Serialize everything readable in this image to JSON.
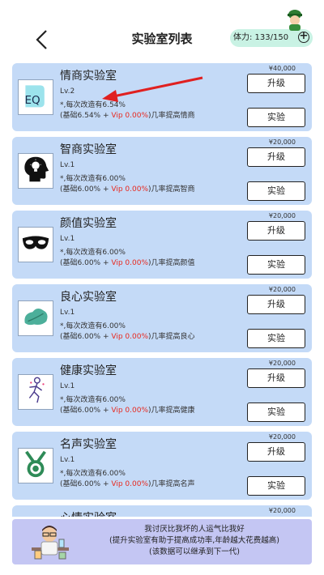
{
  "header": {
    "title": "实验室列表",
    "stamina_label": "体力: 133/150"
  },
  "labs": [
    {
      "name": "情商实验室",
      "level": "Lv.2",
      "desc": "*,每次改造有6.54%",
      "formula_prefix": "(基础6.54% + ",
      "vip": "Vip 0.00%",
      "formula_suffix": ")几率提高情商",
      "price": "¥40,000",
      "upgrade": "升级",
      "experiment": "实验",
      "icon": "eq-icon"
    },
    {
      "name": "智商实验室",
      "level": "Lv.1",
      "desc": "*,每次改造有6.00%",
      "formula_prefix": "(基础6.00% + ",
      "vip": "Vip 0.00%",
      "formula_suffix": ")几率提高智商",
      "price": "¥20,000",
      "upgrade": "升级",
      "experiment": "实验",
      "icon": "brain-bulb-icon"
    },
    {
      "name": "颜值实验室",
      "level": "Lv.1",
      "desc": "*,每次改造有6.00%",
      "formula_prefix": "(基础6.00% + ",
      "vip": "Vip 0.00%",
      "formula_suffix": ")几率提高颜值",
      "price": "¥20,000",
      "upgrade": "升级",
      "experiment": "实验",
      "icon": "mask-icon"
    },
    {
      "name": "良心实验室",
      "level": "Lv.1",
      "desc": "*,每次改造有6.00%",
      "formula_prefix": "(基础6.00% + ",
      "vip": "Vip 0.00%",
      "formula_suffix": ")几率提高良心",
      "price": "¥20,000",
      "upgrade": "升级",
      "experiment": "实验",
      "icon": "leaf-icon"
    },
    {
      "name": "健康实验室",
      "level": "Lv.1",
      "desc": "*,每次改造有6.00%",
      "formula_prefix": "(基础6.00% + ",
      "vip": "Vip 0.00%",
      "formula_suffix": ")几率提高健康",
      "price": "¥20,000",
      "upgrade": "升级",
      "experiment": "实验",
      "icon": "runner-icon"
    },
    {
      "name": "名声实验室",
      "level": "Lv.1",
      "desc": "*,每次改造有6.00%",
      "formula_prefix": "(基础6.00% + ",
      "vip": "Vip 0.00%",
      "formula_suffix": ")几率提高名声",
      "price": "¥20,000",
      "upgrade": "升级",
      "experiment": "实验",
      "icon": "medal-icon"
    },
    {
      "name": "心情实验室",
      "level": "",
      "desc": "",
      "formula_prefix": "",
      "vip": "",
      "formula_suffix": "",
      "price": "¥20,000",
      "upgrade": "",
      "experiment": "",
      "icon": ""
    }
  ],
  "footer": {
    "line1": "我讨厌比我坏的人运气比我好",
    "line2": "(提升实验室有助于提高成功率,年龄越大花费越高)",
    "line3": "(该数据可以继承到下一代)"
  },
  "colors": {
    "card_bg": "#c4daf7",
    "footer_bg": "#c4c6f3",
    "stamina_bg": "#c9f2e4",
    "vip_red": "#e8281e",
    "arrow_red": "#e02020"
  }
}
